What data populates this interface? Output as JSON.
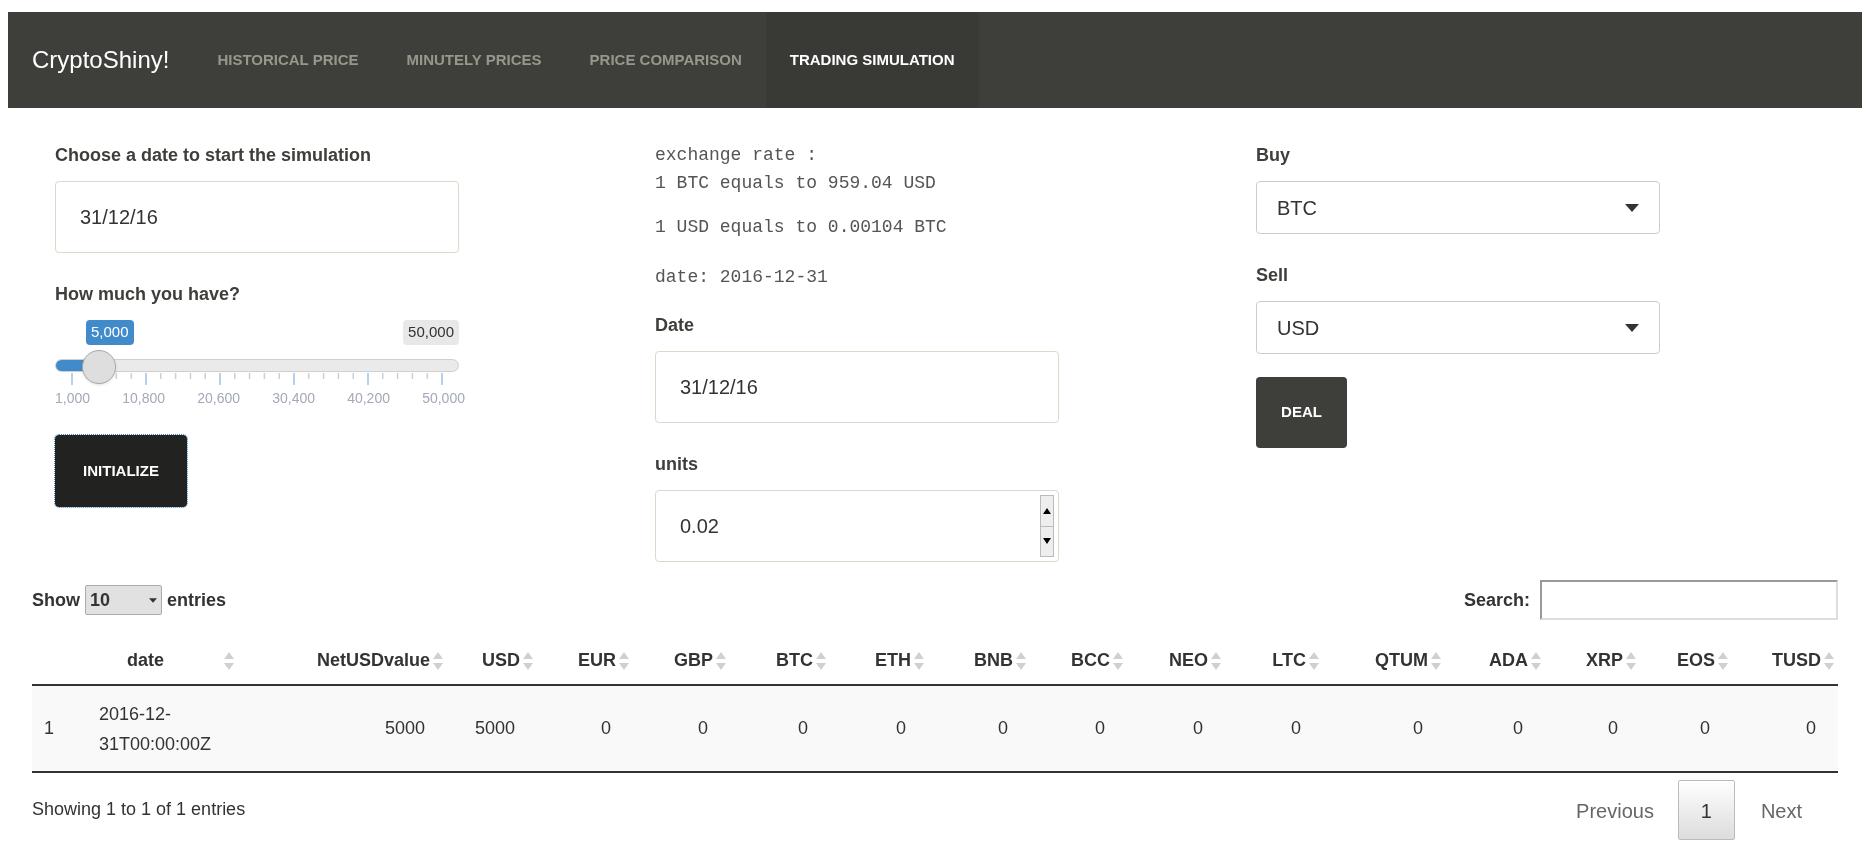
{
  "navbar": {
    "brand": "CryptoShiny!",
    "tabs": [
      {
        "label": "HISTORICAL PRICE",
        "selected": false
      },
      {
        "label": "MINUTELY PRICES",
        "selected": false
      },
      {
        "label": "PRICE COMPARISON",
        "selected": false
      },
      {
        "label": "TRADING SIMULATION",
        "selected": true
      }
    ]
  },
  "left": {
    "date_label": "Choose a date to start the simulation",
    "date_value": "31/12/16",
    "amount_label": "How much you have?",
    "slider": {
      "value_badge": "5,000",
      "max_badge": "50,000",
      "level": 0.0816,
      "tick_labels": [
        "1,000",
        "10,800",
        "20,600",
        "30,400",
        "40,200",
        "50,000"
      ]
    },
    "button": "INITIALIZE"
  },
  "middle": {
    "lines": [
      "exchange rate :",
      "1 BTC equals to 959.04 USD",
      "1 USD equals to 0.00104 BTC",
      "date: 2016-12-31"
    ],
    "date_label": "Date",
    "date_value": "31/12/16",
    "units_label": "units",
    "units_value": "0.02"
  },
  "right": {
    "buy_label": "Buy",
    "buy_value": "BTC",
    "sell_label": "Sell",
    "sell_value": "USD",
    "button": "DEAL"
  },
  "table": {
    "show_label": "Show",
    "length_value": "10",
    "entries_label": "entries",
    "search_label": "Search:",
    "columns": [
      "",
      "date",
      "NetUSDvalue",
      "USD",
      "EUR",
      "GBP",
      "BTC",
      "ETH",
      "BNB",
      "BCC",
      "NEO",
      "LTC",
      "QTUM",
      "ADA",
      "XRP",
      "EOS",
      "TUSD"
    ],
    "rows": [
      [
        "1",
        "2016-12-31T00:00:00Z",
        "5000",
        "5000",
        "0",
        "0",
        "0",
        "0",
        "0",
        "0",
        "0",
        "0",
        "0",
        "0",
        "0",
        "0",
        "0"
      ]
    ],
    "info": "Showing 1 to 1 of 1 entries",
    "pagination": {
      "previous": "Previous",
      "pages": [
        {
          "label": "1",
          "selected": true
        }
      ],
      "next": "Next"
    }
  }
}
